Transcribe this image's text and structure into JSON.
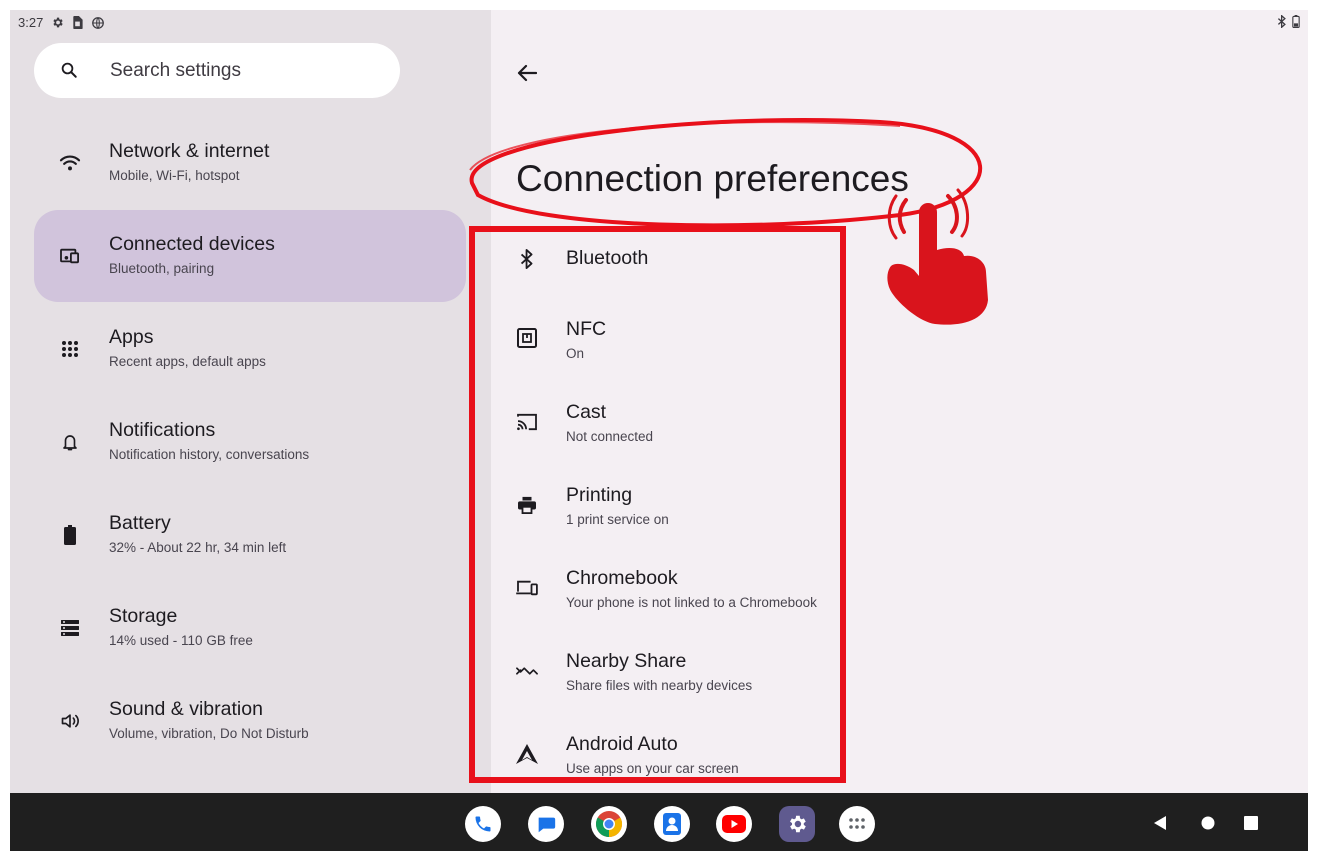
{
  "status_bar": {
    "time": "3:27",
    "left_icons": [
      "settings-gear-icon",
      "sim-card-icon",
      "vpn-globe-icon"
    ],
    "right_icons": [
      "bluetooth-icon",
      "battery-icon"
    ]
  },
  "search": {
    "placeholder": "Search settings"
  },
  "sidebar": {
    "items": [
      {
        "icon": "wifi-icon",
        "title": "Network & internet",
        "subtitle": "Mobile, Wi-Fi, hotspot",
        "selected": false
      },
      {
        "icon": "connected-devices-icon",
        "title": "Connected devices",
        "subtitle": "Bluetooth, pairing",
        "selected": true
      },
      {
        "icon": "apps-grid-icon",
        "title": "Apps",
        "subtitle": "Recent apps, default apps",
        "selected": false
      },
      {
        "icon": "bell-icon",
        "title": "Notifications",
        "subtitle": "Notification history, conversations",
        "selected": false
      },
      {
        "icon": "battery-icon",
        "title": "Battery",
        "subtitle": "32% - About 22 hr, 34 min left",
        "selected": false
      },
      {
        "icon": "storage-icon",
        "title": "Storage",
        "subtitle": "14% used - 110 GB free",
        "selected": false
      },
      {
        "icon": "volume-icon",
        "title": "Sound & vibration",
        "subtitle": "Volume, vibration, Do Not Disturb",
        "selected": false
      }
    ]
  },
  "main": {
    "back_icon": "arrow-back-icon",
    "title": "Connection preferences",
    "items": [
      {
        "icon": "bluetooth-icon",
        "title": "Bluetooth",
        "subtitle": ""
      },
      {
        "icon": "nfc-icon",
        "title": "NFC",
        "subtitle": "On"
      },
      {
        "icon": "cast-icon",
        "title": "Cast",
        "subtitle": "Not connected"
      },
      {
        "icon": "printer-icon",
        "title": "Printing",
        "subtitle": "1 print service on"
      },
      {
        "icon": "chromebook-icon",
        "title": "Chromebook",
        "subtitle": "Your phone is not linked to a Chromebook"
      },
      {
        "icon": "nearby-share-icon",
        "title": "Nearby Share",
        "subtitle": "Share files with nearby devices"
      },
      {
        "icon": "android-auto-icon",
        "title": "Android Auto",
        "subtitle": "Use apps on your car screen"
      }
    ]
  },
  "taskbar": {
    "apps": [
      "phone-app-icon",
      "messages-app-icon",
      "chrome-app-icon",
      "contacts-app-icon",
      "youtube-app-icon",
      "settings-app-icon",
      "app-drawer-icon"
    ],
    "nav": [
      "back-nav-icon",
      "home-nav-icon",
      "recents-nav-icon"
    ]
  },
  "annotations": {
    "color": "#e8101a"
  },
  "colors": {
    "left_bg": "#e5e0e4",
    "right_bg": "#f4eff3",
    "selected_bg": "#d1c4dc",
    "taskbar_bg": "#1f1f1f"
  }
}
